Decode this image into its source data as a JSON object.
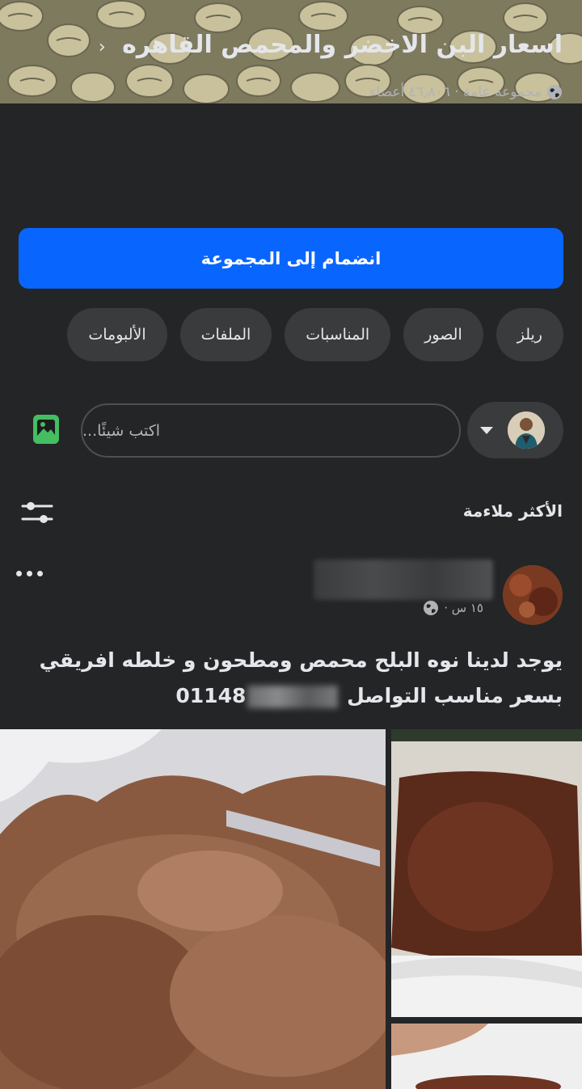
{
  "group": {
    "title": "اسعار البن الاخضر والمحمص  القاهره",
    "chevron": "‹",
    "meta": "مجموعة عامة · ٤٦٫٨٠٦ أعضاء"
  },
  "join_button": {
    "label": "انضمام إلى المجموعة"
  },
  "tabs": [
    {
      "label": "ريلز"
    },
    {
      "label": "الصور"
    },
    {
      "label": "المناسبات"
    },
    {
      "label": "الملفات"
    },
    {
      "label": "الألبومات"
    }
  ],
  "composer": {
    "placeholder": "اكتب شيئًا..."
  },
  "feed": {
    "sort_label": "الأكثر ملاءمة"
  },
  "post": {
    "time": "١٥ س ·",
    "text_line1": "يوجد لدينا نوه البلح محمص ومطحون و خلطه افريقي",
    "text_line2": "بسعر مناسب التواصل",
    "phone_prefix": "01148"
  },
  "colors": {
    "accent": "#0866ff",
    "background": "#242526",
    "chip": "#3a3b3c",
    "photo_icon": "#45bd62"
  },
  "icons": [
    "globe-icon",
    "caret-down-icon",
    "photo-icon",
    "filter-icon",
    "more-icon"
  ]
}
